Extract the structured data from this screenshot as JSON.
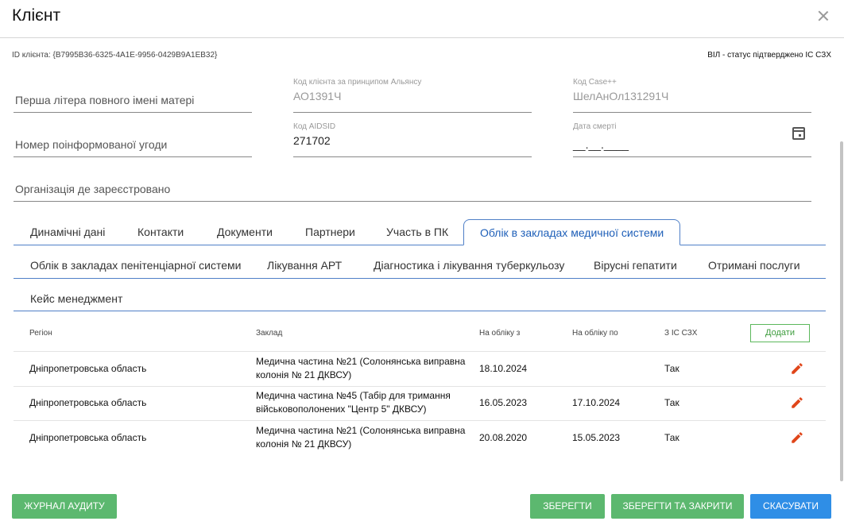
{
  "dialog": {
    "title": "Клієнт"
  },
  "client": {
    "id_label": "ID клієнта: {B7995B36-6325-4A1E-9956-0429B9A1EB32}",
    "status": "ВІЛ - статус підтверджено ІС СЗХ"
  },
  "fields": {
    "mother_initial": {
      "placeholder": "Перша літера повного імені матері"
    },
    "alliance_code": {
      "label": "Код клієнта за принципом Альянсу",
      "value": "АО1391Ч"
    },
    "case_code": {
      "label": "Код Case++",
      "value": "ШелАнОл131291Ч"
    },
    "consent_number": {
      "placeholder": "Номер поінформованої угоди"
    },
    "aidsid": {
      "label": "Код AIDSID",
      "value": "271702"
    },
    "death_date": {
      "label": "Дата смерті",
      "value": "__.__.____"
    },
    "organization": {
      "placeholder": "Організація де зареєстровано"
    }
  },
  "tabs": {
    "row1": [
      "Динамічні дані",
      "Контакти",
      "Документи",
      "Партнери",
      "Участь в ПК",
      "Облік в закладах медичної системи"
    ],
    "row2": [
      "Облік в закладах пенітенціарної системи",
      "Лікування АРТ",
      "Діагностика і лікування туберкульозу",
      "Вірусні гепатити",
      "Отримані послуги"
    ],
    "row3": [
      "Кейс менеджмент"
    ]
  },
  "table": {
    "headers": [
      "Регіон",
      "Заклад",
      "На обліку з",
      "На обліку по",
      "З ІС СЗХ"
    ],
    "add_label": "Додати",
    "rows": [
      {
        "region": "Дніпропетровська область",
        "facility_line1": "Медична частина №21 (Солонянська виправна",
        "facility_line2": "колонія № 21 ДКВСУ)",
        "from": "18.10.2024",
        "to": "",
        "from_ic": "Так"
      },
      {
        "region": "Дніпропетровська область",
        "facility_line1": "Медична частина №45 (Табір для тримання",
        "facility_line2": "військовополонених \"Центр 5\" ДКВСУ)",
        "from": "16.05.2023",
        "to": "17.10.2024",
        "from_ic": "Так"
      },
      {
        "region": "Дніпропетровська область",
        "facility_line1": "Медична частина №21 (Солонянська виправна",
        "facility_line2": "колонія № 21 ДКВСУ)",
        "from": "20.08.2020",
        "to": "15.05.2023",
        "from_ic": "Так"
      }
    ]
  },
  "buttons": {
    "audit": "ЖУРНАЛ АУДИТУ",
    "save": "ЗБЕРЕГТИ",
    "save_close": "ЗБЕРЕГТИ ТА ЗАКРИТИ",
    "cancel": "СКАСУВАТИ"
  },
  "colors": {
    "accent": "#4f7fc7",
    "green": "#5cb86f",
    "blue": "#2f8ee6",
    "edit": "#e0461a"
  },
  "icons": {
    "close": "close-icon",
    "calendar": "calendar-icon",
    "edit": "pencil-icon"
  }
}
